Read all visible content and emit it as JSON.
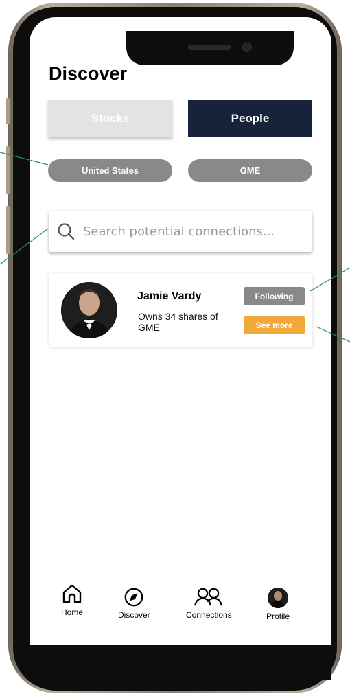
{
  "screen": {
    "title": "Discover"
  },
  "segments": [
    {
      "label": "Stocks",
      "selected": false
    },
    {
      "label": "People",
      "selected": true
    }
  ],
  "filters": {
    "country": "United States",
    "ticker": "GME"
  },
  "search": {
    "placeholder": "Search potential connections..."
  },
  "results": [
    {
      "name": "Jamie Vardy",
      "description": "Owns 34 shares of GME",
      "follow_label": "Following",
      "more_label": "See more"
    }
  ],
  "tab_bar": {
    "items": [
      {
        "label": "Home",
        "icon": "home-icon"
      },
      {
        "label": "Discover",
        "icon": "compass-icon"
      },
      {
        "label": "Connections",
        "icon": "users-icon"
      },
      {
        "label": "Profile",
        "icon": "avatar"
      }
    ]
  },
  "colors": {
    "primary_dark": "#17223b",
    "accent_orange": "#f2a93b",
    "neutral_grey": "#898989",
    "inactive_segment": "#e3e3e3",
    "annotation_line": "#2e8b6a"
  }
}
